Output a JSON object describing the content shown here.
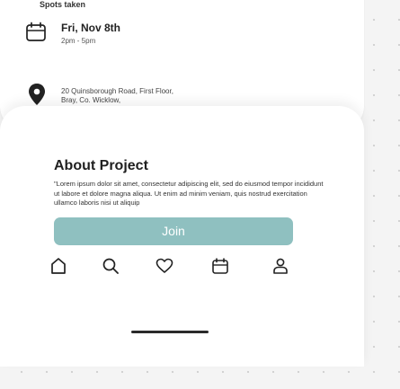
{
  "event": {
    "spots_label": "Spots taken",
    "date_title": "Fri, Nov 8th",
    "time_range": "2pm - 5pm",
    "address_line1": "20 Quinsborough Road, First Floor,",
    "address_line2": "Bray, Co. Wicklow,"
  },
  "about": {
    "title": "About Project",
    "body": "\"Lorem ipsum dolor sit amet, consectetur adipiscing elit, sed do eiusmod tempor incididunt ut labore et dolore magna aliqua. Ut enim ad minim veniam, quis nostrud exercitation ullamco laboris nisi ut aliquip"
  },
  "actions": {
    "join_label": "Join"
  },
  "nav": {
    "items": [
      {
        "name": "home",
        "icon": "home-icon"
      },
      {
        "name": "search",
        "icon": "search-icon"
      },
      {
        "name": "favorites",
        "icon": "heart-icon"
      },
      {
        "name": "calendar",
        "icon": "calendar-icon"
      },
      {
        "name": "profile",
        "icon": "profile-icon"
      }
    ]
  },
  "colors": {
    "accent": "#8fc0c0",
    "text": "#222222",
    "background": "#f4f4f4"
  }
}
